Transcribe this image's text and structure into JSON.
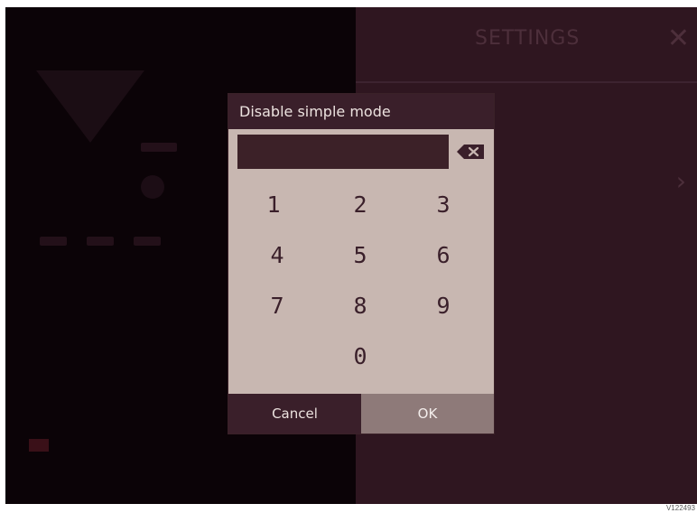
{
  "settings": {
    "title": "SETTINGS",
    "close_glyph": "✕",
    "chevron_glyph": "›"
  },
  "dialog": {
    "title": "Disable simple mode",
    "pin_value": "",
    "keypad": {
      "k1": "1",
      "k2": "2",
      "k3": "3",
      "k4": "4",
      "k5": "5",
      "k6": "6",
      "k7": "7",
      "k8": "8",
      "k9": "9",
      "k0": "0"
    },
    "cancel_label": "Cancel",
    "ok_label": "OK"
  },
  "figure_id": "V122493",
  "colors": {
    "dialog_body": "#c8b7b1",
    "dialog_header": "#3a1f2a",
    "ok_button": "#8e7a79",
    "overlay_left": "#0b0307",
    "overlay_right": "#2f1620"
  },
  "icons": {
    "backspace": "backspace-icon",
    "close": "close-icon",
    "chevron": "chevron-right-icon"
  }
}
